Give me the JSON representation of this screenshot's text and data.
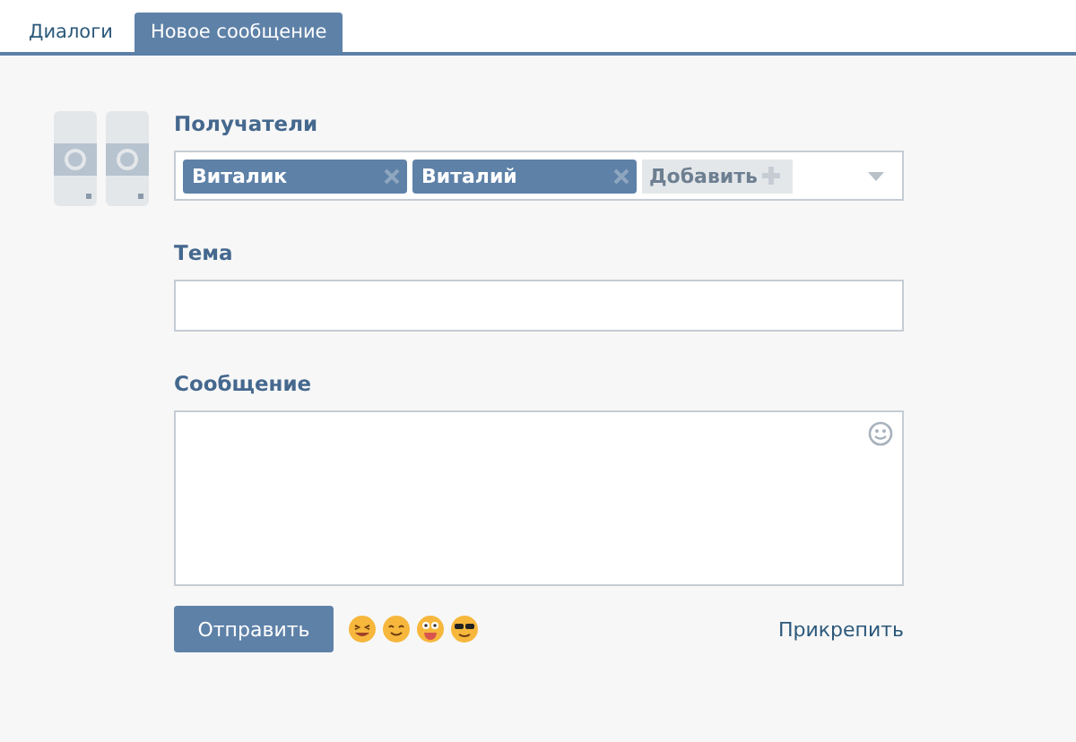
{
  "tabs": [
    {
      "label": "Диалоги",
      "selected": false
    },
    {
      "label": "Новое сообщение",
      "selected": true
    }
  ],
  "recipients": {
    "label": "Получатели",
    "tokens": [
      "Виталик",
      "Виталий"
    ],
    "add_button": "Добавить"
  },
  "subject": {
    "label": "Тема"
  },
  "message": {
    "label": "Сообщение"
  },
  "send_button": "Отправить",
  "attach_link": "Прикрепить"
}
